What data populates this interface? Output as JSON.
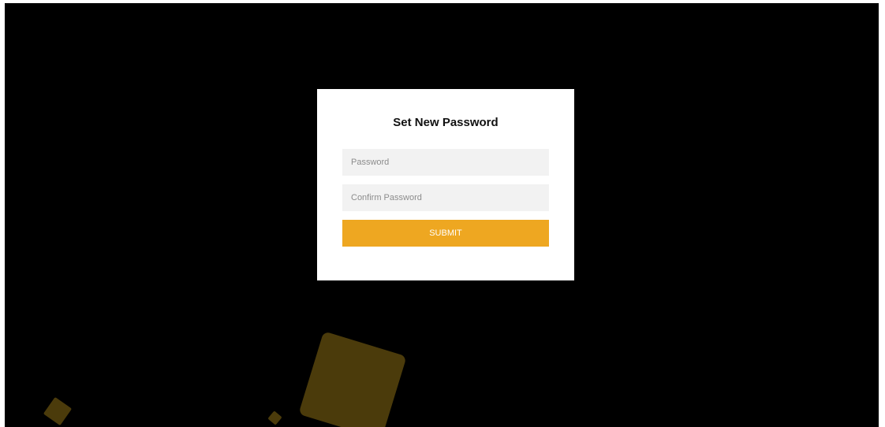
{
  "form": {
    "title": "Set New Password",
    "password_placeholder": "Password",
    "confirm_placeholder": "Confirm Password",
    "submit_label": "SUBMIT"
  },
  "colors": {
    "background": "#000000",
    "card": "#ffffff",
    "input_bg": "#f2f2f2",
    "accent": "#eea721",
    "decor_square": "#4b3b0b"
  }
}
